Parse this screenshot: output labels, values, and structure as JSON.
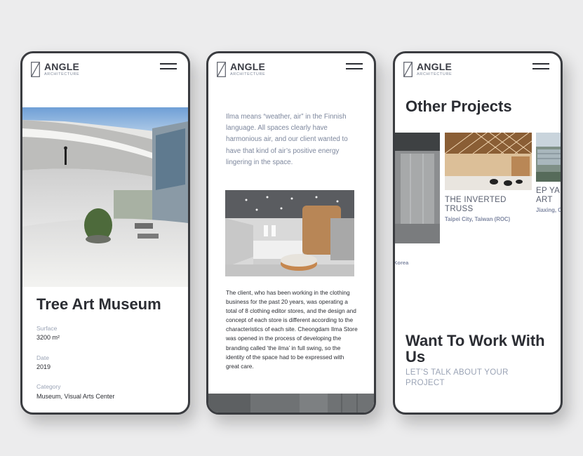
{
  "brand": {
    "name": "ANGLE",
    "tagline": "ARCHITECTURE"
  },
  "phone1": {
    "project_title": "Tree Art Museum",
    "meta": [
      {
        "label": "Surface",
        "value": "3200 m²"
      },
      {
        "label": "Date",
        "value": "2019"
      },
      {
        "label": "Category",
        "value": "Museum, Visual Arts Center"
      }
    ]
  },
  "phone2": {
    "intro": "Ilma means “weather, air” in the Finnish language. All spaces clearly have harmonious air, and our client wanted to have that kind of air’s positive energy lingering in the space.",
    "body": "The client, who has been working in the clothing business for the past 20 years, was operating a total of 8 clothing editor stores, and the design and concept of each store is different according to the characteristics of each site. Cheongdam Ilma Store was opened in the process of developing the branding called ‘the ilma’ in full swing, so the identity of the space had to be expressed with great care."
  },
  "phone3": {
    "other_title": "Other Projects",
    "partial_location": "Korea",
    "projects": [
      {
        "title": "THE INVERTED TRUSS",
        "location": "Taipei City, Taiwan (ROC)"
      },
      {
        "title": "EP YA & ART",
        "location": "Jiaxing, C"
      }
    ],
    "cta_title": "Want To Work With Us",
    "cta_sub": "LET’S TALK ABOUT YOUR PROJECT"
  },
  "colors": {
    "text": "#2b2d33",
    "muted": "#9aa3b5",
    "frame": "#3a3c40",
    "background": "#ececed"
  },
  "icons": [
    "angle-logo-icon",
    "hamburger-menu-icon"
  ]
}
